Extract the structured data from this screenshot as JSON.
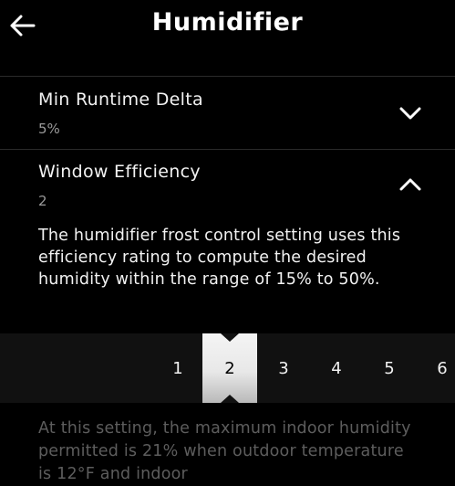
{
  "header": {
    "title": "Humidifier",
    "back_icon": "arrow-left-icon"
  },
  "settings": [
    {
      "label": "Min Runtime Delta",
      "value": "5%",
      "expanded": false,
      "icon": "chevron-down-icon"
    },
    {
      "label": "Window Efficiency",
      "value": "2",
      "expanded": true,
      "icon": "chevron-up-icon"
    }
  ],
  "description": "The humidifier frost control setting uses this efficiency rating to compute the desired humidity within the range of 15% to 50%.",
  "picker": {
    "options": [
      "1",
      "2",
      "3",
      "4",
      "5",
      "6"
    ],
    "selected": "2"
  },
  "note": "At this setting, the maximum indoor humidity permitted is 21% when outdoor temperature is 12°F and indoor",
  "colors": {
    "background": "#000000",
    "row_value": "#9a9a9a",
    "note_text": "#5d5d5d"
  }
}
